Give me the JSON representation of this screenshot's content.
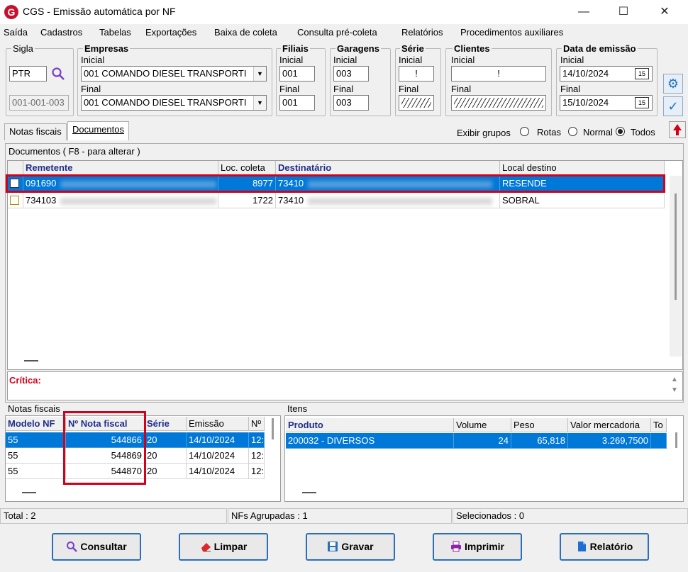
{
  "window": {
    "title": "CGS - Emissão automática por NF",
    "logo": "G"
  },
  "menu": [
    "Saída",
    "Cadastros",
    "Tabelas",
    "Exportações",
    "Baixa de coleta",
    "Consulta pré-coleta",
    "Relatórios",
    "Procedimentos auxiliares"
  ],
  "filters": {
    "sigla": {
      "title": "Sigla",
      "value": "PTR",
      "code": "001-001-003"
    },
    "empresas": {
      "title": "Empresas",
      "inicial_label": "Inicial",
      "inicial": "001 COMANDO DIESEL TRANSPORTI",
      "final_label": "Final",
      "final": "001 COMANDO DIESEL TRANSPORTI"
    },
    "filiais": {
      "title": "Filiais",
      "inicial_label": "Inicial",
      "inicial": "001",
      "final_label": "Final",
      "final": "001"
    },
    "garagens": {
      "title": "Garagens",
      "inicial_label": "Inicial",
      "inicial": "003",
      "final_label": "Final",
      "final": "003"
    },
    "serie": {
      "title": "Série",
      "inicial_label": "Inicial",
      "inicial": "!",
      "final_label": "Final"
    },
    "clientes": {
      "title": "Clientes",
      "inicial_label": "Inicial",
      "inicial": "!",
      "final_label": "Final"
    },
    "data_emissao": {
      "title": "Data de emissão",
      "inicial_label": "Inicial",
      "inicial": "14/10/2024",
      "final_label": "Final",
      "final": "15/10/2024",
      "cal_icon": "15"
    }
  },
  "tabs": [
    "Notas fiscais",
    "Documentos"
  ],
  "grouping": {
    "label": "Exibir grupos",
    "options": [
      "Rotas",
      "Normal",
      "Todos"
    ],
    "selected": "Todos"
  },
  "documents": {
    "caption": "Documentos ( F8 - para alterar )",
    "columns": [
      "Remetente",
      "Loc. coleta",
      "Destinatário",
      "Local destino"
    ],
    "rows": [
      {
        "remetente": "091690",
        "loc_coleta": "8977",
        "destinatario": "73410",
        "local_destino": "RESENDE",
        "selected": true
      },
      {
        "remetente": "734103",
        "loc_coleta": "1722",
        "destinatario": "73410",
        "local_destino": "SOBRAL",
        "selected": false
      }
    ]
  },
  "critica_label": "Crítica:",
  "notas": {
    "caption": "Notas fiscais",
    "columns": [
      "Modelo NF",
      "Nº Nota fiscal",
      "Série",
      "Emissão",
      "Nº"
    ],
    "rows": [
      {
        "modelo": "55",
        "numero": "544866",
        "serie": "20",
        "emissao": "14/10/2024",
        "n": "12:"
      },
      {
        "modelo": "55",
        "numero": "544869",
        "serie": "20",
        "emissao": "14/10/2024",
        "n": "12:"
      },
      {
        "modelo": "55",
        "numero": "544870",
        "serie": "20",
        "emissao": "14/10/2024",
        "n": "12:"
      }
    ]
  },
  "itens": {
    "caption": "Itens",
    "columns": [
      "Produto",
      "Volume",
      "Peso",
      "Valor mercadoria",
      "To"
    ],
    "rows": [
      {
        "produto": "200032 - DIVERSOS",
        "volume": "24",
        "peso": "65,818",
        "valor": "3.269,7500"
      }
    ]
  },
  "status": {
    "total": "Total : 2",
    "agrupadas": "NFs Agrupadas : 1",
    "selecionados": "Selecionados : 0"
  },
  "buttons": {
    "consultar": "Consultar",
    "limpar": "Limpar",
    "gravar": "Gravar",
    "imprimir": "Imprimir",
    "relatorio": "Relatório"
  },
  "colors": {
    "selection": "#0078d7",
    "highlight": "#d0021b",
    "header_blue": "#1f2d8a"
  }
}
